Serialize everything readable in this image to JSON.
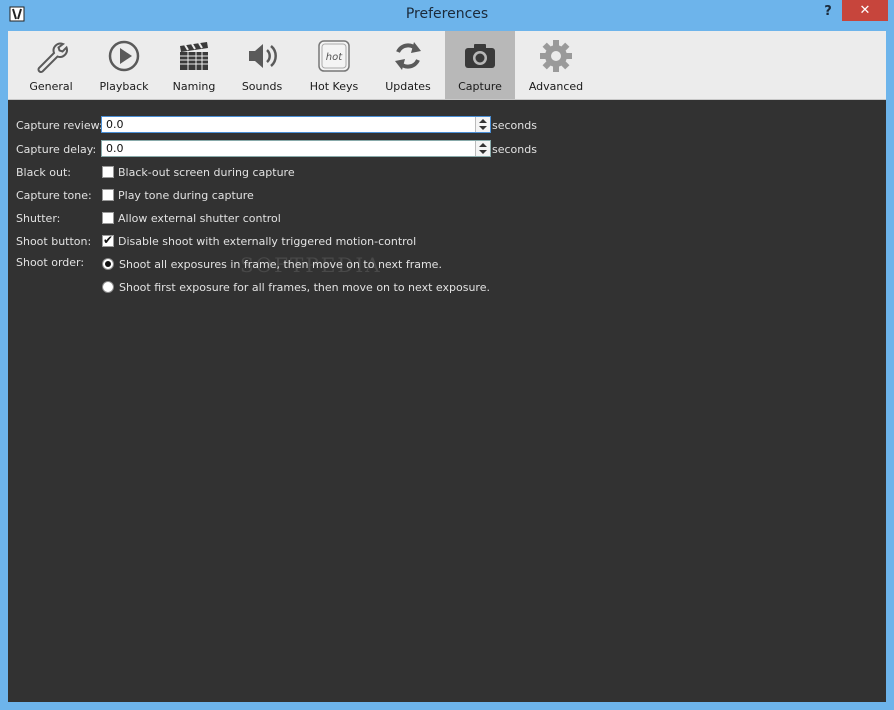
{
  "window": {
    "title": "Preferences",
    "help_label": "?",
    "close_label": "✕"
  },
  "tabs": [
    {
      "label": "General",
      "icon": "wrench-icon"
    },
    {
      "label": "Playback",
      "icon": "play-icon"
    },
    {
      "label": "Naming",
      "icon": "clapperboard-icon"
    },
    {
      "label": "Sounds",
      "icon": "speaker-icon"
    },
    {
      "label": "Hot Keys",
      "icon": "hot-keys-icon"
    },
    {
      "label": "Updates",
      "icon": "refresh-icon"
    },
    {
      "label": "Capture",
      "icon": "camera-icon",
      "active": true
    },
    {
      "label": "Advanced",
      "icon": "gear-icon"
    }
  ],
  "capture": {
    "review_label": "Capture review:",
    "review_value": "0.0",
    "review_unit": "seconds",
    "delay_label": "Capture delay:",
    "delay_value": "0.0",
    "delay_unit": "seconds",
    "blackout_label": "Black out:",
    "blackout_text": "Black-out screen during capture",
    "blackout_checked": false,
    "tone_label": "Capture tone:",
    "tone_text": "Play tone during capture",
    "tone_checked": false,
    "shutter_label": "Shutter:",
    "shutter_text": "Allow external shutter control",
    "shutter_checked": false,
    "shoot_button_label": "Shoot button:",
    "shoot_button_text": "Disable shoot with externally triggered motion-control",
    "shoot_button_checked": true,
    "shoot_order_label": "Shoot order:",
    "shoot_order_options": [
      {
        "text": "Shoot all exposures in frame, then move on to next frame.",
        "selected": true
      },
      {
        "text": "Shoot first exposure for all frames, then move on to next exposure.",
        "selected": false
      }
    ]
  },
  "watermark": "SOFTPEDIA"
}
